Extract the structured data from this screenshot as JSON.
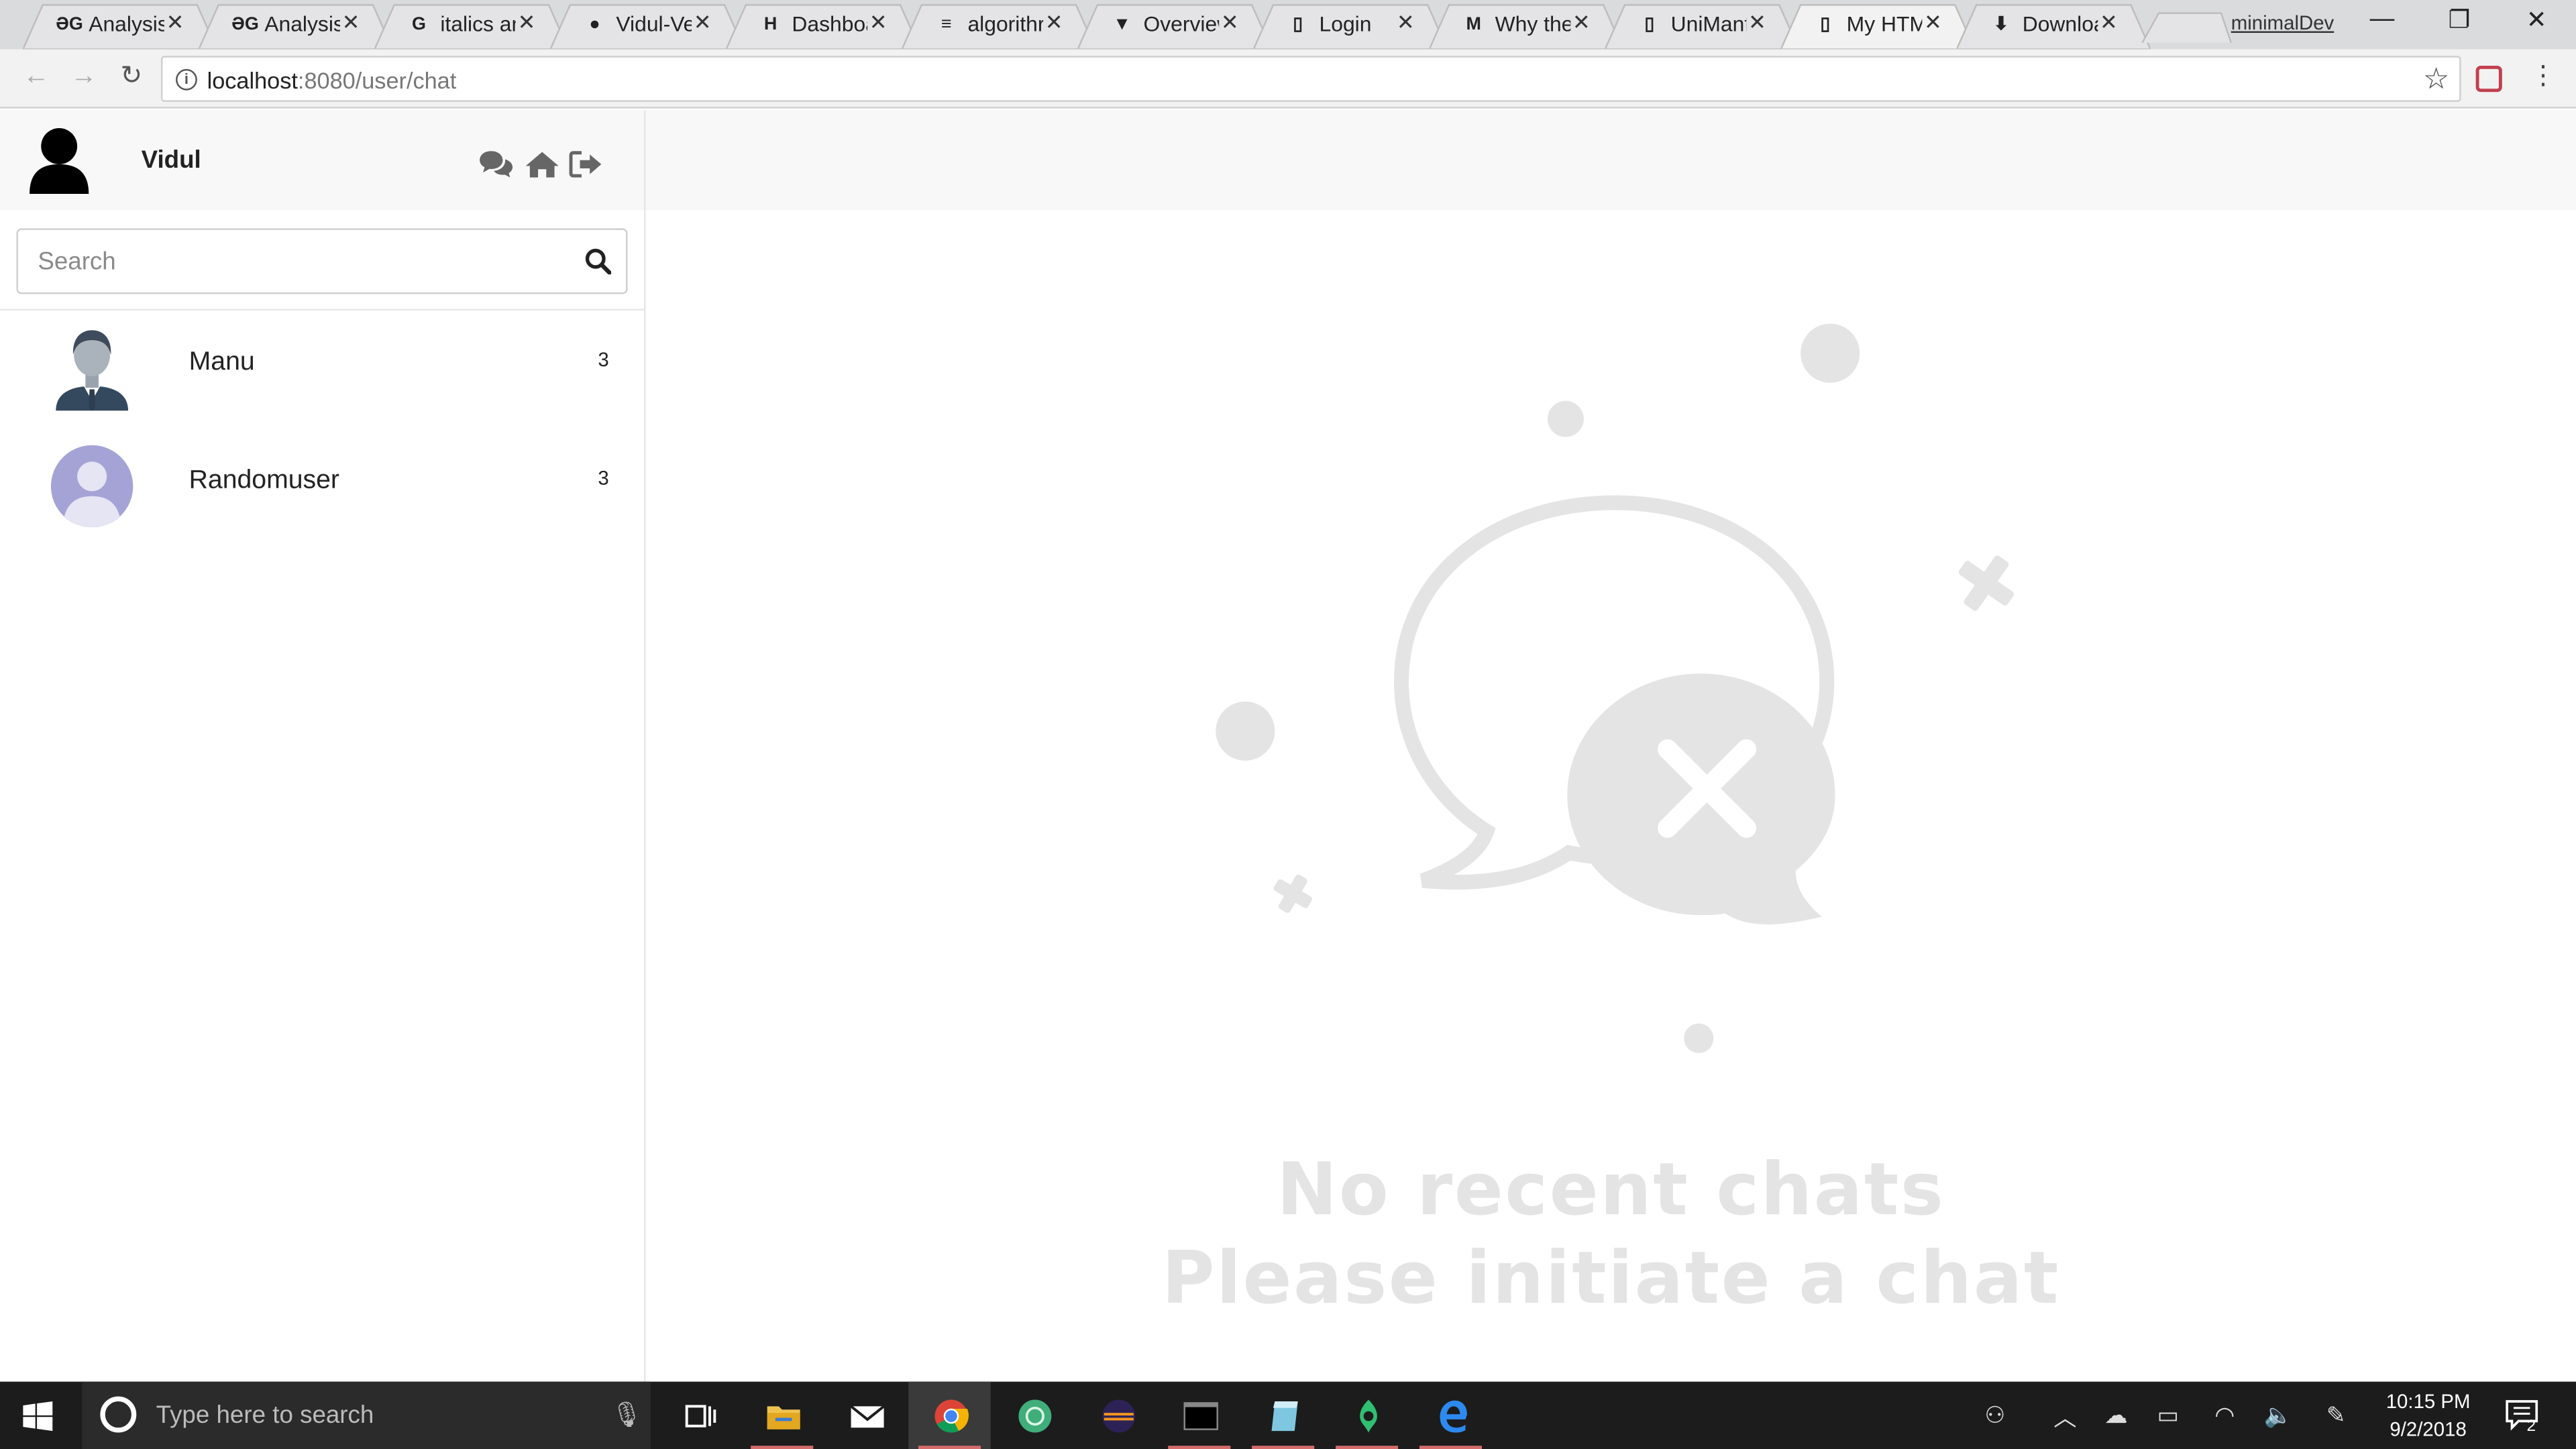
{
  "browser": {
    "tabs": [
      {
        "title": "Analysis",
        "favicon": "geeksforgeeks-icon",
        "fav_text": "ƏG"
      },
      {
        "title": "Analysis",
        "favicon": "geeksforgeeks-icon",
        "fav_text": "ƏG"
      },
      {
        "title": "italics an",
        "favicon": "google-icon",
        "fav_text": "G"
      },
      {
        "title": "Vidul-Ve",
        "favicon": "github-icon",
        "fav_text": "●"
      },
      {
        "title": "Dashboa",
        "favicon": "hackerrank-icon",
        "fav_text": "H"
      },
      {
        "title": "algorithr",
        "favicon": "stackoverflow-icon",
        "fav_text": "≡"
      },
      {
        "title": "Overview",
        "favicon": "shield-icon",
        "fav_text": "▼"
      },
      {
        "title": "Login",
        "favicon": "page-icon",
        "fav_text": "▯"
      },
      {
        "title": "Why the",
        "favicon": "medium-icon",
        "fav_text": "M"
      },
      {
        "title": "UniManf",
        "favicon": "page-icon",
        "fav_text": "▯"
      },
      {
        "title": "My HTM",
        "favicon": "page-icon",
        "fav_text": "▯",
        "active": true
      },
      {
        "title": "Downloa",
        "favicon": "download-icon",
        "fav_text": "⬇"
      }
    ],
    "profile_name": "minimalDev",
    "url_host": "localhost",
    "url_path": ":8080/user/chat"
  },
  "app": {
    "user_name": "Vidul",
    "search_placeholder": "Search",
    "contacts": [
      {
        "name": "Manu",
        "count": "3",
        "avatar": "man-in-suit-avatar"
      },
      {
        "name": "Randomuser",
        "count": "3",
        "avatar": "default-user-avatar"
      }
    ],
    "empty_title": "No recent chats",
    "empty_subtitle": "Please initiate a chat"
  },
  "taskbar": {
    "search_placeholder": "Type here to search",
    "time": "10:15 PM",
    "date": "9/2/2018",
    "notification_count": "2"
  },
  "colors": {
    "accent_running": "#d36b6b",
    "illustration_gray": "#e4e4e4",
    "taskbar_bg": "#1c1c1c"
  }
}
